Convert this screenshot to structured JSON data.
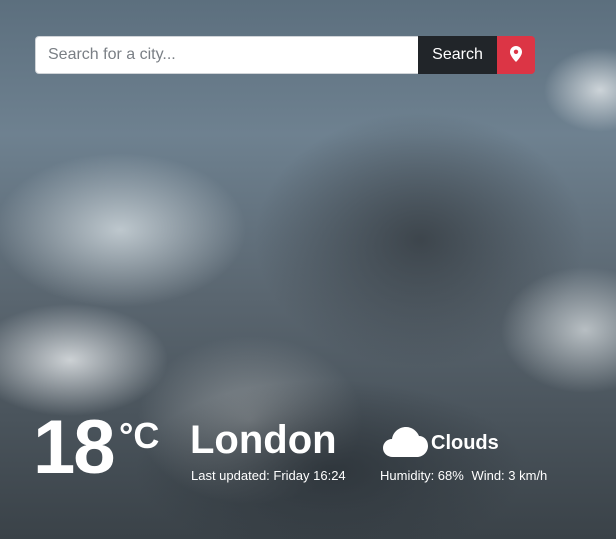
{
  "search": {
    "placeholder": "Search for a city...",
    "value": "",
    "button_label": "Search"
  },
  "icons": {
    "location": "map-marker-icon",
    "condition": "cloud-icon"
  },
  "colors": {
    "search_button_bg": "#212529",
    "location_button_bg": "#dc3545",
    "text": "#ffffff"
  },
  "weather": {
    "temperature": "18",
    "unit": "°C",
    "city": "London",
    "last_updated": "Last updated: Friday 16:24",
    "condition": "Clouds",
    "humidity": "Humidity: 68%",
    "wind": "Wind: 3 km/h"
  }
}
